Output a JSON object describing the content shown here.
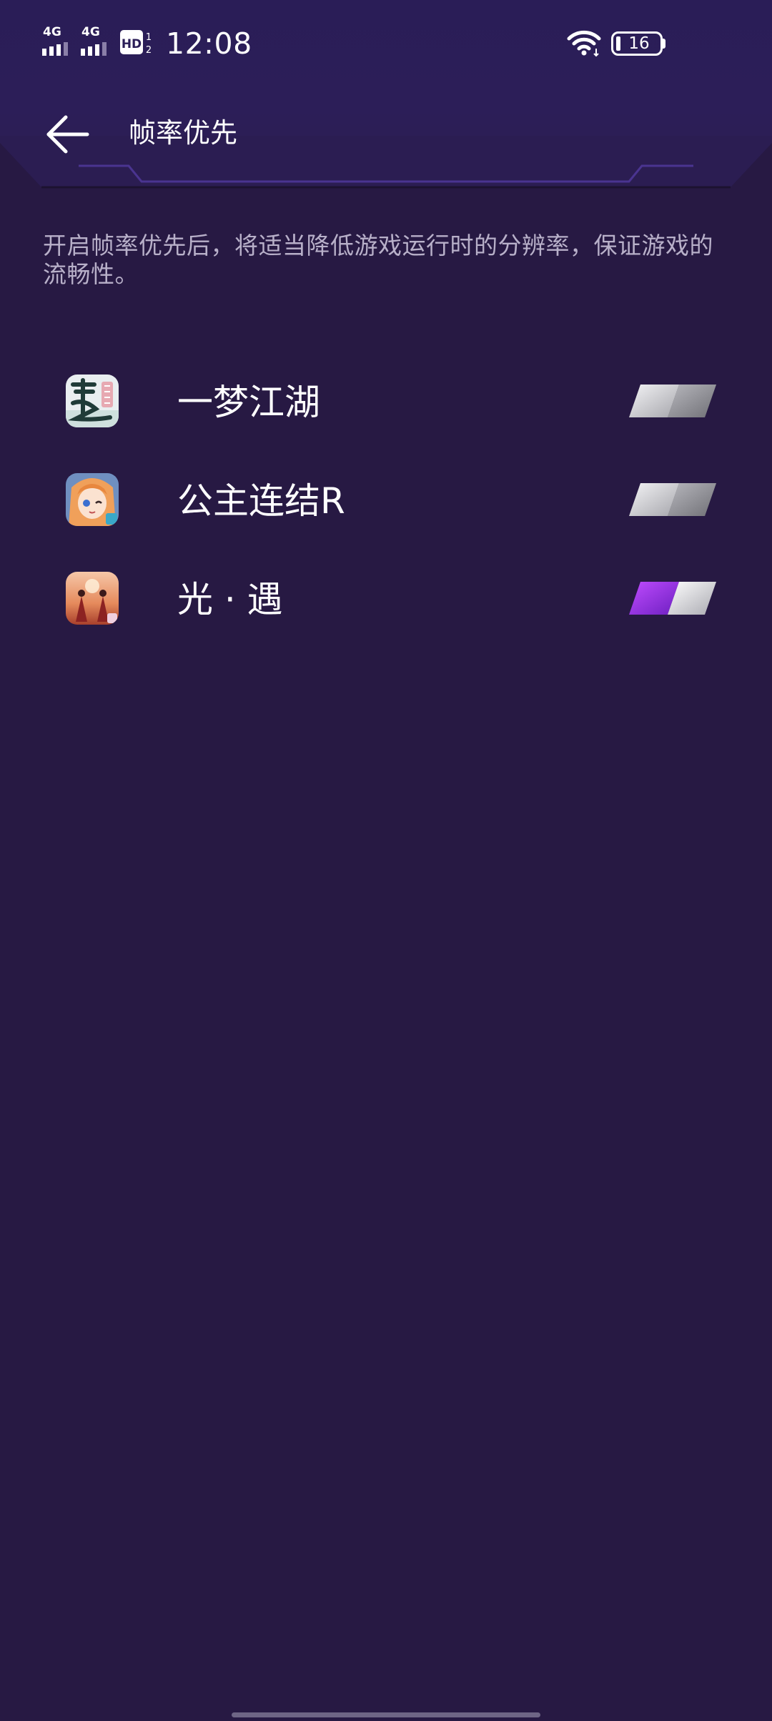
{
  "status_bar": {
    "sim1_network": "4G",
    "sim2_network": "4G",
    "hd_label": "HD",
    "clock": "12:08",
    "battery_level": "16"
  },
  "title_bar": {
    "title": "帧率优先"
  },
  "description": "开启帧率优先后，将适当降低游戏运行时的分辨率，保证游戏的流畅性。",
  "games": [
    {
      "name": "一梦江湖",
      "icon": "yimeng-jianghu-app-icon",
      "enabled": false
    },
    {
      "name": "公主连结R",
      "icon": "princess-connect-app-icon",
      "enabled": false
    },
    {
      "name": "光 · 遇",
      "icon": "sky-children-of-light-app-icon",
      "enabled": true
    }
  ],
  "colors": {
    "background": "#271943",
    "accent": "#9b3cf0",
    "description_text": "#b8b0c9",
    "toggle_off": "#8f8f94"
  }
}
